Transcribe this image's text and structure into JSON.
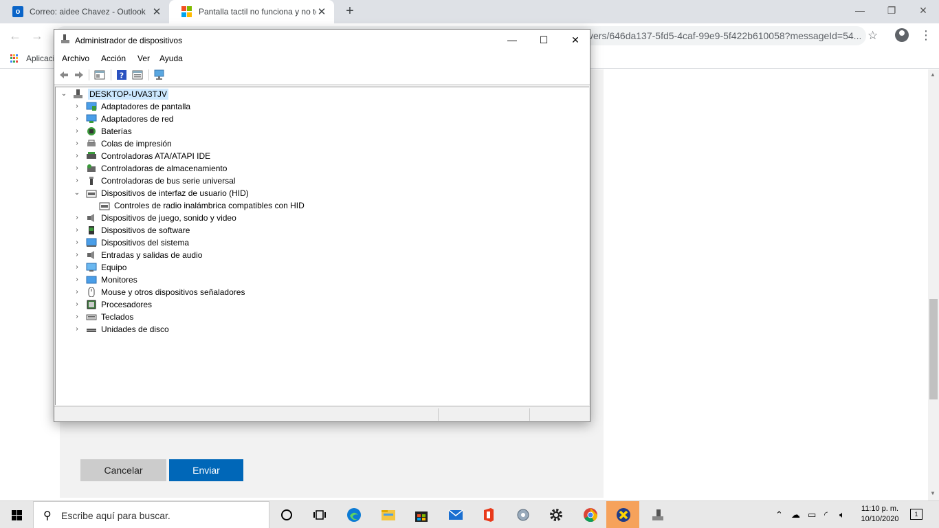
{
  "browser": {
    "tabs": [
      {
        "title": "Correo: aidee Chavez - Outlook",
        "favicon": "outlook-icon",
        "close": "✕"
      },
      {
        "title": "Pantalla tactil no funciona y no te",
        "favicon": "microsoft-icon",
        "close": "✕"
      }
    ],
    "new_tab": "+",
    "url_visible": "vers/646da137-5fd5-4caf-99e9-5f422b610058?messageId=54...",
    "bookmarks_label": "Aplicaci"
  },
  "page": {
    "cancel_label": "Cancelar",
    "send_label": "Enviar",
    "send_color": "#0067b8"
  },
  "device_manager": {
    "title": "Administrador de dispositivos",
    "menus": [
      "Archivo",
      "Acción",
      "Ver",
      "Ayuda"
    ],
    "root": "DESKTOP-UVA3TJV",
    "items": [
      {
        "label": "Adaptadores de pantalla",
        "expanded": false
      },
      {
        "label": "Adaptadores de red",
        "expanded": false
      },
      {
        "label": "Baterías",
        "expanded": false
      },
      {
        "label": "Colas de impresión",
        "expanded": false
      },
      {
        "label": "Controladoras ATA/ATAPI IDE",
        "expanded": false
      },
      {
        "label": "Controladoras de almacenamiento",
        "expanded": false
      },
      {
        "label": "Controladoras de bus serie universal",
        "expanded": false
      },
      {
        "label": "Dispositivos de interfaz de usuario (HID)",
        "expanded": true
      },
      {
        "label": "Controles de radio inalámbrica compatibles con HID",
        "child": true
      },
      {
        "label": "Dispositivos de juego, sonido y video",
        "expanded": false
      },
      {
        "label": "Dispositivos de software",
        "expanded": false
      },
      {
        "label": "Dispositivos del sistema",
        "expanded": false
      },
      {
        "label": "Entradas y salidas de audio",
        "expanded": false
      },
      {
        "label": "Equipo",
        "expanded": false
      },
      {
        "label": "Monitores",
        "expanded": false
      },
      {
        "label": "Mouse y otros dispositivos señaladores",
        "expanded": false
      },
      {
        "label": "Procesadores",
        "expanded": false
      },
      {
        "label": "Teclados",
        "expanded": false
      },
      {
        "label": "Unidades de disco",
        "expanded": false
      }
    ]
  },
  "taskbar": {
    "search_placeholder": "Escribe aquí para buscar.",
    "time": "11:10 p. m.",
    "date": "10/10/2020",
    "notifications": "1"
  }
}
